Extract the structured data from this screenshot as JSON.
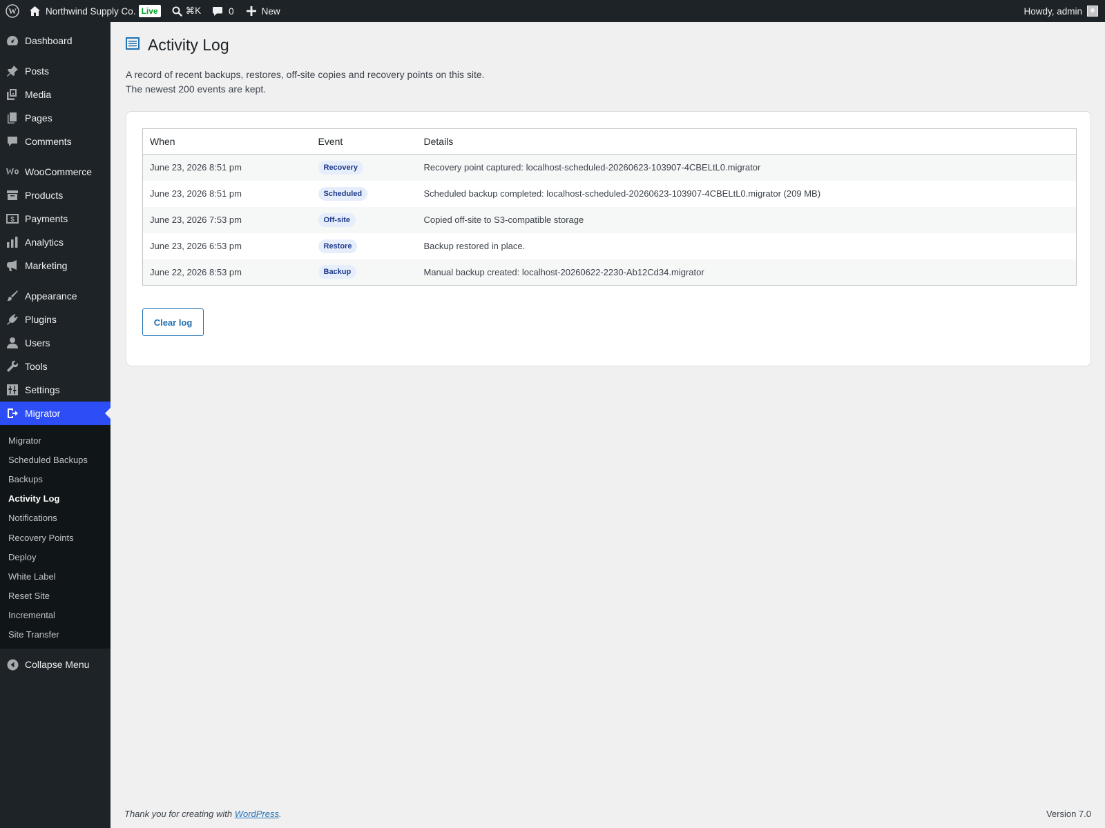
{
  "adminbar": {
    "site_name": "Northwind Supply Co.",
    "live_badge": "Live",
    "search_shortcut": "⌘K",
    "comments_count": "0",
    "new_label": "New",
    "howdy": "Howdy, admin"
  },
  "sidebar": {
    "items": [
      {
        "label": "Dashboard",
        "icon": "dashboard-icon"
      },
      {
        "label": "Posts",
        "icon": "pin-icon"
      },
      {
        "label": "Media",
        "icon": "media-icon"
      },
      {
        "label": "Pages",
        "icon": "pages-icon"
      },
      {
        "label": "Comments",
        "icon": "comment-icon"
      },
      {
        "label": "WooCommerce",
        "icon": "woocommerce-icon"
      },
      {
        "label": "Products",
        "icon": "archive-icon"
      },
      {
        "label": "Payments",
        "icon": "dollar-icon"
      },
      {
        "label": "Analytics",
        "icon": "bar-chart-icon"
      },
      {
        "label": "Marketing",
        "icon": "megaphone-icon"
      },
      {
        "label": "Appearance",
        "icon": "brush-icon"
      },
      {
        "label": "Plugins",
        "icon": "plug-icon"
      },
      {
        "label": "Users",
        "icon": "user-icon"
      },
      {
        "label": "Tools",
        "icon": "wrench-icon"
      },
      {
        "label": "Settings",
        "icon": "sliders-icon"
      },
      {
        "label": "Migrator",
        "icon": "migrate-icon"
      }
    ],
    "submenu": [
      "Migrator",
      "Scheduled Backups",
      "Backups",
      "Activity Log",
      "Notifications",
      "Recovery Points",
      "Deploy",
      "White Label",
      "Reset Site",
      "Incremental",
      "Site Transfer"
    ],
    "collapse_label": "Collapse Menu"
  },
  "page": {
    "title": "Activity Log",
    "intro": "A record of recent backups, restores, off-site copies and recovery points on this site. The newest 200 events are kept."
  },
  "table": {
    "headers": [
      "When",
      "Event",
      "Details"
    ],
    "rows": [
      {
        "when": "June 23, 2026 8:51 pm",
        "event": "Recovery",
        "details": "Recovery point captured: localhost-scheduled-20260623-103907-4CBELtL0.migrator"
      },
      {
        "when": "June 23, 2026 8:51 pm",
        "event": "Scheduled",
        "details": "Scheduled backup completed: localhost-scheduled-20260623-103907-4CBELtL0.migrator (209 MB)"
      },
      {
        "when": "June 23, 2026 7:53 pm",
        "event": "Off-site",
        "details": "Copied off-site to S3-compatible storage"
      },
      {
        "when": "June 23, 2026 6:53 pm",
        "event": "Restore",
        "details": "Backup restored in place."
      },
      {
        "when": "June 22, 2026 8:53 pm",
        "event": "Backup",
        "details": "Manual backup created: localhost-20260622-2230-Ab12Cd34.migrator"
      }
    ]
  },
  "actions": {
    "clear_log": "Clear log"
  },
  "footer": {
    "thanks_prefix": "Thank you for creating with ",
    "wordpress_link": "WordPress",
    "thanks_suffix": ".",
    "version": "Version 7.0"
  },
  "colors": {
    "adminbar_bg": "#1d2327",
    "active_menu": "#2d4ef6",
    "link": "#2271b1",
    "badge_bg": "#e7eefb",
    "live_green": "#00a32a"
  }
}
